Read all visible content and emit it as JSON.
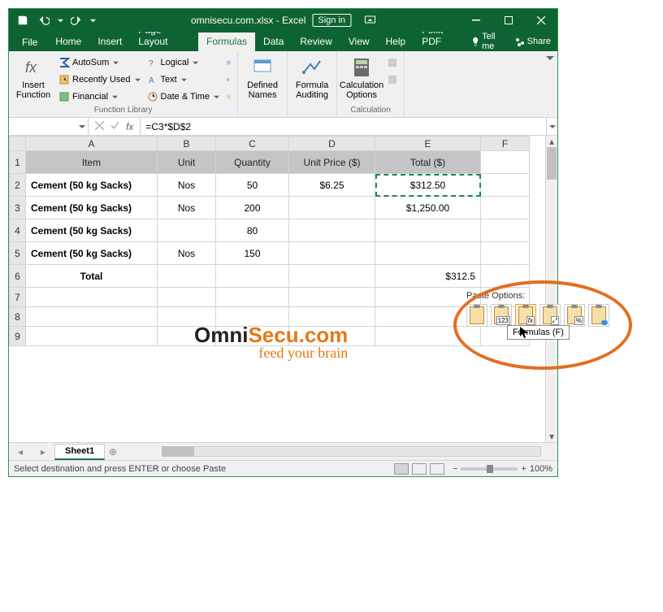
{
  "title": "omnisecu.com.xlsx - Excel",
  "signin": "Sign in",
  "tabs": {
    "file": "File",
    "home": "Home",
    "insert": "Insert",
    "pagelayout": "Page Layout",
    "formulas": "Formulas",
    "data": "Data",
    "review": "Review",
    "view": "View",
    "help": "Help",
    "foxit": "Foxit PDF",
    "tellme": "Tell me",
    "share": "Share"
  },
  "ribbon": {
    "insert_fn": "Insert\nFunction",
    "autosum": "AutoSum",
    "recent": "Recently Used",
    "financial": "Financial",
    "logical": "Logical",
    "text": "Text",
    "datetime": "Date & Time",
    "defined": "Defined\nNames",
    "auditing": "Formula\nAuditing",
    "calcopt": "Calculation\nOptions",
    "group1": "Function Library",
    "group2": "Calculation"
  },
  "namebox": "",
  "formula": "=C3*$D$2",
  "col_labels": [
    "A",
    "B",
    "C",
    "D",
    "E",
    "F"
  ],
  "headers": {
    "item": "Item",
    "unit": "Unit",
    "qty": "Quantity",
    "price": "Unit Price ($)",
    "total": "Total ($)"
  },
  "rows": [
    {
      "item": "Cement (50 kg Sacks)",
      "unit": "Nos",
      "qty": "50",
      "price": "$6.25",
      "total": "$312.50"
    },
    {
      "item": "Cement (50 kg Sacks)",
      "unit": "Nos",
      "qty": "200",
      "price": "",
      "total": "$1,250.00"
    },
    {
      "item": "Cement (50 kg Sacks)",
      "unit": "",
      "qty": "80",
      "price": "",
      "total": ""
    },
    {
      "item": "Cement (50 kg Sacks)",
      "unit": "Nos",
      "qty": "150",
      "price": "",
      "total": ""
    }
  ],
  "total_row": {
    "label": "Total",
    "value": "$312.5"
  },
  "watermark": {
    "brand1": "Omni",
    "brand2": "Secu",
    "brand3": ".com",
    "tag": "feed your brain"
  },
  "sheet": "Sheet1",
  "status": "Select destination and press ENTER or choose Paste",
  "zoom": "100%",
  "paste": {
    "label": "Paste Options:",
    "tooltip": "Formulas (F)"
  }
}
